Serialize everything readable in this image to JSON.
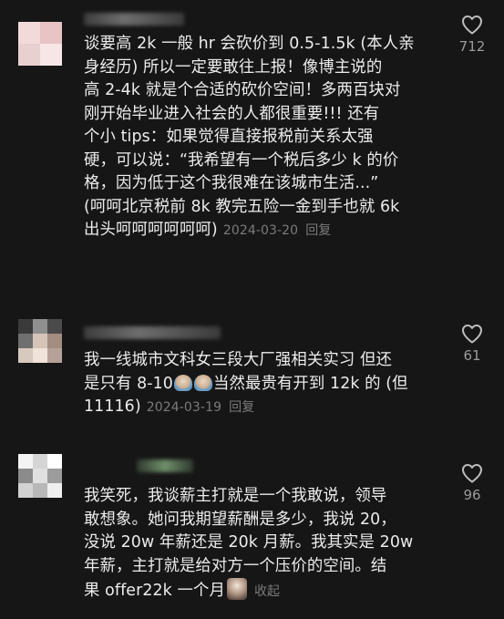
{
  "comments": [
    {
      "lines": [
        "谈要高 2k 一般 hr 会砍价到 0.5-1.5k (本人亲",
        "身经历) 所以一定要敢往上报！像博主说的",
        "高 2-4k 就是个合适的砍价空间！多两百块对",
        "刚开始毕业进入社会的人都很重要!!! 还有",
        "个小 tips：如果觉得直接报税前关系太强",
        "硬，可以说：“我希望有一个税后多少 k 的价",
        "格，因为低于这个我很难在该城市生活...”",
        "(呵呵北京税前 8k 教完五险一金到手也就 6k"
      ],
      "last_line": "出头呵呵呵呵呵呵)",
      "date": "2024-03-20",
      "reply": "回复",
      "likes": "712"
    },
    {
      "line1": "我一线城市文科女三段大厂强相关实习 但还",
      "line2_pre": "是只有 8-10",
      "line2_post": "当然最贵有开到 12k 的 (但",
      "line3": "11116)",
      "date": "2024-03-19",
      "reply": "回复",
      "likes": "61"
    },
    {
      "lines": [
        "我笑死，我谈薪主打就是一个我敢说，领导",
        "敢想象。她问我期望薪酬是多少，我说 20，",
        "没说 20w 年薪还是 20k 月薪。我其实是 20w",
        "年薪，主打就是给对方一个压价的空间。结"
      ],
      "last_line": "果 offer22k 一个月",
      "collapse": "收起",
      "likes": "96"
    }
  ],
  "icons": {
    "like": "heart-outline-icon",
    "emoji": "crying-face-emoji-icon",
    "sticker": "face-sticker-icon"
  },
  "colors": {
    "background": "#161616",
    "text": "#ececec",
    "meta": "#7b7b7b"
  }
}
